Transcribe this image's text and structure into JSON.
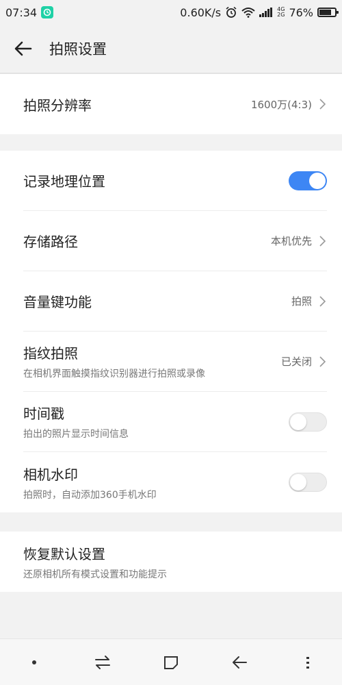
{
  "status_bar": {
    "time": "07:34",
    "speed": "0.60K/s",
    "network_top": "4G",
    "network_bottom": "2G",
    "battery_text": "76%",
    "battery_level": 0.76,
    "icons": [
      "app-notification-icon",
      "alarm-icon",
      "wifi-icon",
      "signal-icon",
      "battery-icon"
    ]
  },
  "header": {
    "title": "拍照设置"
  },
  "sections": {
    "resolution": {
      "title": "拍照分辨率",
      "value": "1600万(4:3)"
    },
    "location": {
      "title": "记录地理位置",
      "enabled": true
    },
    "storage": {
      "title": "存储路径",
      "value": "本机优先"
    },
    "volume_key": {
      "title": "音量键功能",
      "value": "拍照"
    },
    "fingerprint": {
      "title": "指纹拍照",
      "subtitle": "在相机界面触摸指纹识别器进行拍照或录像",
      "value": "已关闭"
    },
    "timestamp": {
      "title": "时间戳",
      "subtitle": "拍出的照片显示时间信息",
      "enabled": false
    },
    "watermark": {
      "title": "相机水印",
      "subtitle": "拍照时，自动添加360手机水印",
      "enabled": false
    },
    "restore": {
      "title": "恢复默认设置",
      "subtitle": "还原相机所有模式设置和功能提示"
    }
  },
  "colors": {
    "accent": "#3d86f4",
    "background": "#f2f2f2"
  },
  "nav_bar": {
    "icons": [
      "menu-dot-icon",
      "switch-icon",
      "home-square-icon",
      "back-icon",
      "more-icon"
    ]
  }
}
